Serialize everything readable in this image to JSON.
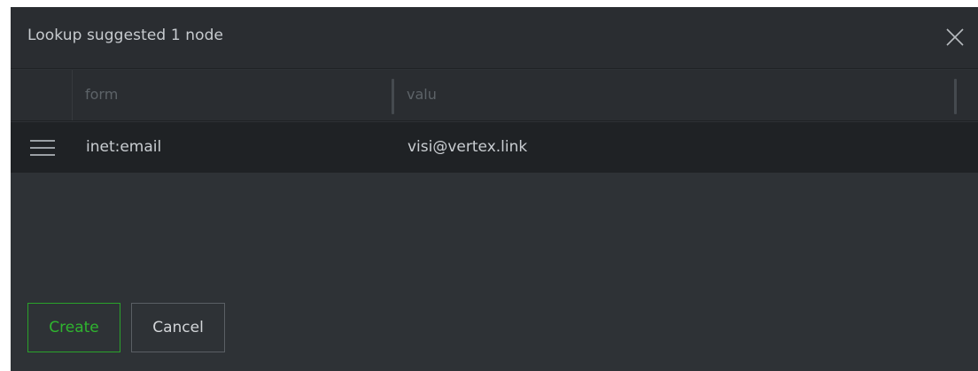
{
  "dialog": {
    "title": "Lookup suggested 1 node",
    "close_icon": "close-icon"
  },
  "grid": {
    "columns": [
      {
        "label": "form"
      },
      {
        "label": "valu"
      }
    ],
    "rows": [
      {
        "handle_icon": "hamburger-menu-icon",
        "form": "inet:email",
        "valu": "visi@vertex.link"
      }
    ]
  },
  "actions": {
    "create_label": "Create",
    "cancel_label": "Cancel"
  },
  "colors": {
    "dialog_bg": "#2e3236",
    "header_bg": "#2a2d31",
    "row_bg": "#1f2225",
    "accent_green": "#2fb52f"
  }
}
